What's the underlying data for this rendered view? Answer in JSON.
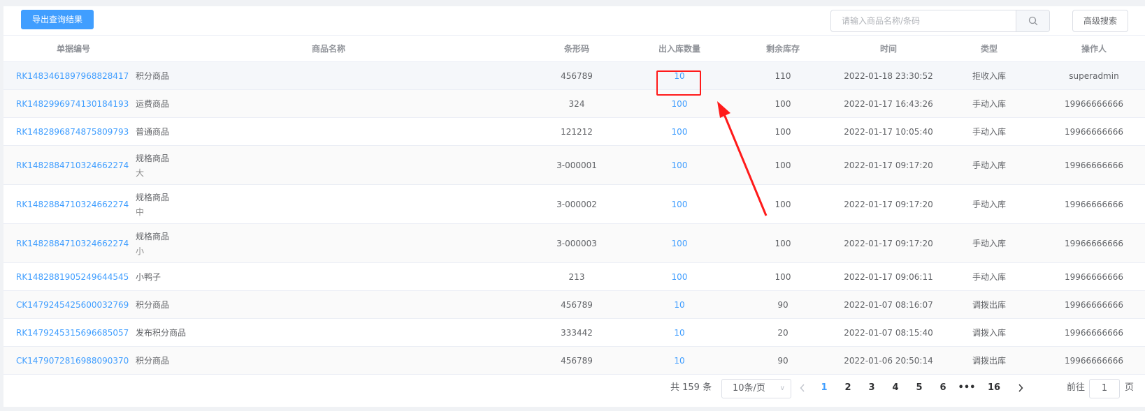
{
  "toolbar": {
    "export_label": "导出查询结果",
    "search_placeholder": "请输入商品名称/条码",
    "advanced_label": "高级搜索"
  },
  "table": {
    "headers": {
      "code": "单据编号",
      "name": "商品名称",
      "barcode": "条形码",
      "qty": "出入库数量",
      "stock": "剩余库存",
      "time": "时间",
      "type": "类型",
      "operator": "操作人"
    },
    "rows": [
      {
        "code": "RK1483461897968828417",
        "name": "积分商品",
        "spec": "",
        "barcode": "456789",
        "qty": "10",
        "stock": "110",
        "time": "2022-01-18 23:30:52",
        "type": "拒收入库",
        "operator": "superadmin"
      },
      {
        "code": "RK1482996974130184193",
        "name": "运费商品",
        "spec": "",
        "barcode": "324",
        "qty": "100",
        "stock": "100",
        "time": "2022-01-17 16:43:26",
        "type": "手动入库",
        "operator": "19966666666"
      },
      {
        "code": "RK1482896874875809793",
        "name": "普通商品",
        "spec": "",
        "barcode": "121212",
        "qty": "100",
        "stock": "100",
        "time": "2022-01-17 10:05:40",
        "type": "手动入库",
        "operator": "19966666666"
      },
      {
        "code": "RK1482884710324662274",
        "name": "规格商品",
        "spec": "大",
        "barcode": "3-000001",
        "qty": "100",
        "stock": "100",
        "time": "2022-01-17 09:17:20",
        "type": "手动入库",
        "operator": "19966666666"
      },
      {
        "code": "RK1482884710324662274",
        "name": "规格商品",
        "spec": "中",
        "barcode": "3-000002",
        "qty": "100",
        "stock": "100",
        "time": "2022-01-17 09:17:20",
        "type": "手动入库",
        "operator": "19966666666"
      },
      {
        "code": "RK1482884710324662274",
        "name": "规格商品",
        "spec": "小",
        "barcode": "3-000003",
        "qty": "100",
        "stock": "100",
        "time": "2022-01-17 09:17:20",
        "type": "手动入库",
        "operator": "19966666666"
      },
      {
        "code": "RK1482881905249644545",
        "name": "小鸭子",
        "spec": "",
        "barcode": "213",
        "qty": "100",
        "stock": "100",
        "time": "2022-01-17 09:06:11",
        "type": "手动入库",
        "operator": "19966666666"
      },
      {
        "code": "CK1479245425600032769",
        "name": "积分商品",
        "spec": "",
        "barcode": "456789",
        "qty": "10",
        "stock": "90",
        "time": "2022-01-07 08:16:07",
        "type": "调拨出库",
        "operator": "19966666666"
      },
      {
        "code": "RK1479245315696685057",
        "name": "发布积分商品",
        "spec": "",
        "barcode": "333442",
        "qty": "10",
        "stock": "20",
        "time": "2022-01-07 08:15:40",
        "type": "调拨入库",
        "operator": "19966666666"
      },
      {
        "code": "CK1479072816988090370",
        "name": "积分商品",
        "spec": "",
        "barcode": "456789",
        "qty": "10",
        "stock": "90",
        "time": "2022-01-06 20:50:14",
        "type": "调拨出库",
        "operator": "19966666666"
      }
    ]
  },
  "pagination": {
    "total_text": "共 159 条",
    "page_size": "10条/页",
    "pages": [
      "1",
      "2",
      "3",
      "4",
      "5",
      "6",
      "•••",
      "16"
    ],
    "current": "1",
    "goto_prefix": "前往",
    "goto_value": "1",
    "goto_suffix": "页"
  },
  "colors": {
    "primary": "#409eff",
    "annotation": "#ff1a1a"
  }
}
